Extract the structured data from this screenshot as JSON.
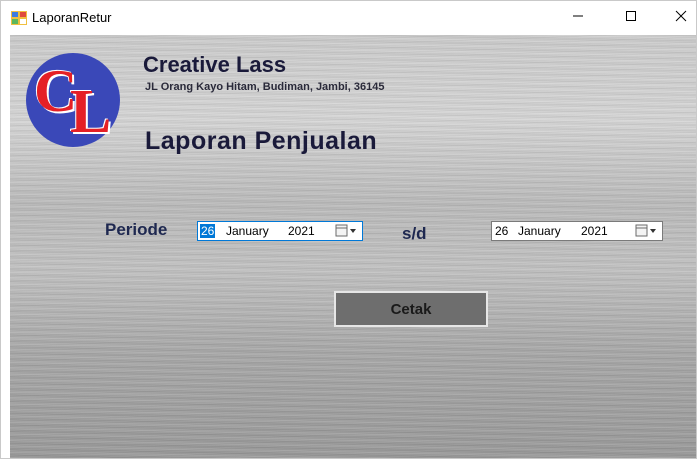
{
  "window": {
    "title": "LaporanRetur",
    "icon": "form-icon",
    "controls": [
      "minimize-icon",
      "maximize-icon",
      "close-icon"
    ]
  },
  "header": {
    "logo_letters": {
      "first": "C",
      "second": "L"
    },
    "company": "Creative Lass",
    "address": "JL Orang Kayo Hitam, Budiman, Jambi, 36145",
    "report_title": "Laporan Penjualan"
  },
  "filter": {
    "periode_label": "Periode",
    "separator_label": "s/d",
    "start_date": {
      "day": "26",
      "month": "January",
      "year": "2021"
    },
    "end_date": {
      "day": "26",
      "month": "January",
      "year": "2021"
    }
  },
  "actions": {
    "print_label": "Cetak"
  },
  "colors": {
    "logo_circle": "#3a48b8",
    "logo_letters": "#e52026",
    "title_text": "#1a1a3a",
    "label_text": "#1e2850",
    "selection": "#0078d7",
    "button_bg": "#6e6e6e"
  }
}
